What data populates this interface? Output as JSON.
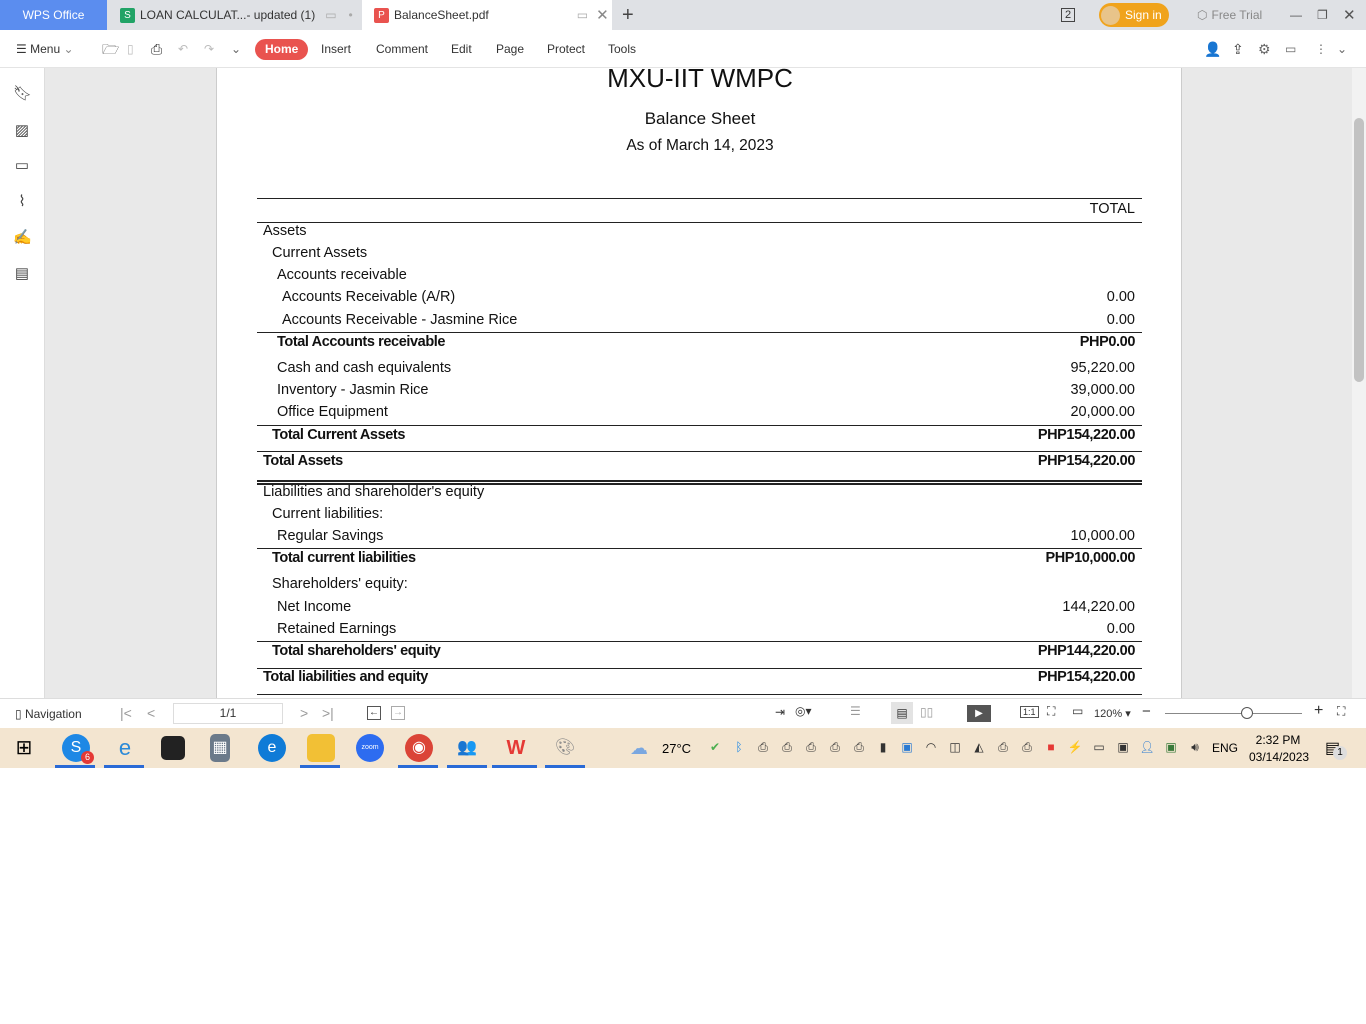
{
  "tabs": {
    "app": "WPS Office",
    "tab1": "LOAN CALCULAT...- updated (1)",
    "tab2": "BalanceSheet.pdf",
    "badge": "2",
    "sign_in": "Sign in",
    "free_trial": "Free Trial"
  },
  "toolbar": {
    "menu": "Menu",
    "items": [
      "Home",
      "Insert",
      "Comment",
      "Edit",
      "Page",
      "Protect",
      "Tools"
    ]
  },
  "doc": {
    "org": "MXU-IIT WMPC",
    "title": "Balance Sheet",
    "date": "As of March 14, 2023",
    "col_header": "TOTAL",
    "rows": [
      {
        "label": "Assets",
        "value": "",
        "indent": 0,
        "bold": false
      },
      {
        "label": "Current Assets",
        "value": "",
        "indent": 1,
        "bold": false
      },
      {
        "label": "Accounts receivable",
        "value": "",
        "indent": 2,
        "bold": false
      },
      {
        "label": "Accounts Receivable (A/R)",
        "value": "0.00",
        "indent": 3,
        "bold": false
      },
      {
        "label": "Accounts Receivable - Jasmine Rice",
        "value": "0.00",
        "indent": 3,
        "bold": false
      },
      {
        "label": "Total Accounts receivable",
        "value": "PHP0.00",
        "indent": 2,
        "bold": true
      },
      {
        "label": "Cash and cash equivalents",
        "value": "95,220.00",
        "indent": 2,
        "bold": false
      },
      {
        "label": "Inventory - Jasmin Rice",
        "value": "39,000.00",
        "indent": 2,
        "bold": false
      },
      {
        "label": "Office Equipment",
        "value": "20,000.00",
        "indent": 2,
        "bold": false
      },
      {
        "label": "Total Current Assets",
        "value": "PHP154,220.00",
        "indent": 1,
        "bold": true
      },
      {
        "label": "Total Assets",
        "value": "PHP154,220.00",
        "indent": 0,
        "bold": true
      },
      {
        "label": "Liabilities and shareholder's equity",
        "value": "",
        "indent": 0,
        "bold": false
      },
      {
        "label": "Current liabilities:",
        "value": "",
        "indent": 1,
        "bold": false
      },
      {
        "label": "Regular Savings",
        "value": "10,000.00",
        "indent": 2,
        "bold": false
      },
      {
        "label": "Total current liabilities",
        "value": "PHP10,000.00",
        "indent": 1,
        "bold": true
      },
      {
        "label": "Shareholders' equity:",
        "value": "",
        "indent": 1,
        "bold": false
      },
      {
        "label": "Net Income",
        "value": "144,220.00",
        "indent": 2,
        "bold": false
      },
      {
        "label": "Retained Earnings",
        "value": "0.00",
        "indent": 2,
        "bold": false
      },
      {
        "label": "Total shareholders' equity",
        "value": "PHP144,220.00",
        "indent": 1,
        "bold": true
      },
      {
        "label": "Total liabilities and equity",
        "value": "PHP154,220.00",
        "indent": 0,
        "bold": true
      }
    ]
  },
  "status": {
    "navigation": "Navigation",
    "page": "1/1",
    "zoom": "120%",
    "zoom_fraction": 0.55
  },
  "taskbar": {
    "weather": "27°C",
    "lang": "ENG",
    "time": "2:32 PM",
    "date": "03/14/2023",
    "skype_badge": "6",
    "notif": "1"
  }
}
